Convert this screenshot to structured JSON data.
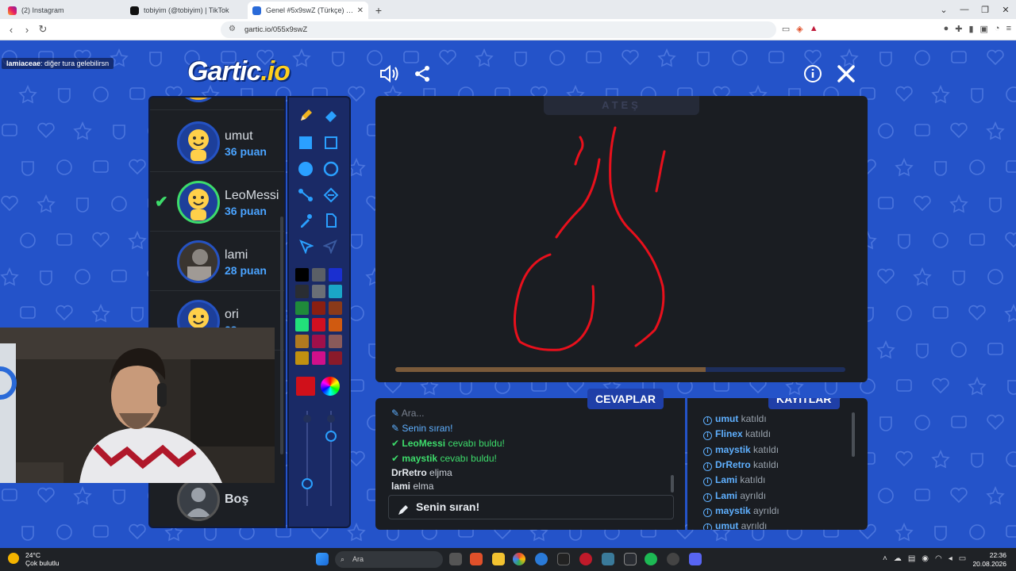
{
  "browser": {
    "tabs": [
      {
        "title": "(2) Instagram",
        "active": false
      },
      {
        "title": "tobiyim (@tobiyim) | TikTok",
        "active": false
      },
      {
        "title": "Genel #5x9swZ (Türkçe) - Gartic.io",
        "active": true
      }
    ],
    "new_tab": "+",
    "url": "gartic.io/055x9swZ"
  },
  "game": {
    "notification": {
      "user": "lamiaceae",
      "text": ": diğer tura gelebilirsn"
    },
    "logo_main": "Gartic",
    "logo_suffix": ".io",
    "word_hint": "ATEŞ",
    "timer_fraction": 0.69,
    "players": [
      {
        "name": "umut",
        "score": "36 puan",
        "guessed": false
      },
      {
        "name": "LeoMessi",
        "score": "36 puan",
        "guessed": true
      },
      {
        "name": "lami",
        "score": "28 puan",
        "guessed": false
      },
      {
        "name": "ori",
        "score": "23 puan",
        "guessed": false
      }
    ],
    "empty_slot": "Boş",
    "answers_title": "CEVAPLAR",
    "logs_title": "KAYITLAR",
    "answers": [
      {
        "user": "",
        "text": "Ara...",
        "kind": "plain"
      },
      {
        "user": "",
        "text": "Senin sıran!",
        "kind": "blue"
      },
      {
        "user": "LeoMessi",
        "text": "cevabı buldu!",
        "kind": "green"
      },
      {
        "user": "maystik",
        "text": "cevabı buldu!",
        "kind": "green"
      },
      {
        "user": "DrRetro",
        "text": "eljma",
        "kind": "plain"
      },
      {
        "user": "lami",
        "text": "elma",
        "kind": "plain"
      }
    ],
    "chat_placeholder": "Senin sıran!",
    "logs": [
      {
        "user": "umut",
        "action": "katıldı"
      },
      {
        "user": "Flinex",
        "action": "katıldı"
      },
      {
        "user": "maystik",
        "action": "katıldı"
      },
      {
        "user": "DrRetro",
        "action": "katıldı"
      },
      {
        "user": "Lami",
        "action": "katıldı"
      },
      {
        "user": "Lami",
        "action": "ayrıldı"
      },
      {
        "user": "maystik",
        "action": "ayrıldı"
      },
      {
        "user": "umut",
        "action": "ayrıldı"
      }
    ],
    "palette": [
      "#000000",
      "#5a5f66",
      "#1a2fd0",
      "#2a2d33",
      "#6a6f76",
      "#1aa6c7",
      "#1f8a3a",
      "#8a1f12",
      "#8a3a1a",
      "#22e07a",
      "#d01020",
      "#d05a10",
      "#b07a20",
      "#a0104a",
      "#8a5a5a",
      "#c09010",
      "#d0108a",
      "#8a1a2a"
    ],
    "selected_color": "#d0101a"
  },
  "taskbar": {
    "temperature": "24°C",
    "weather": "Çok bulutlu",
    "search": "Ara",
    "time": "22:36",
    "date": "20.08.2026"
  }
}
